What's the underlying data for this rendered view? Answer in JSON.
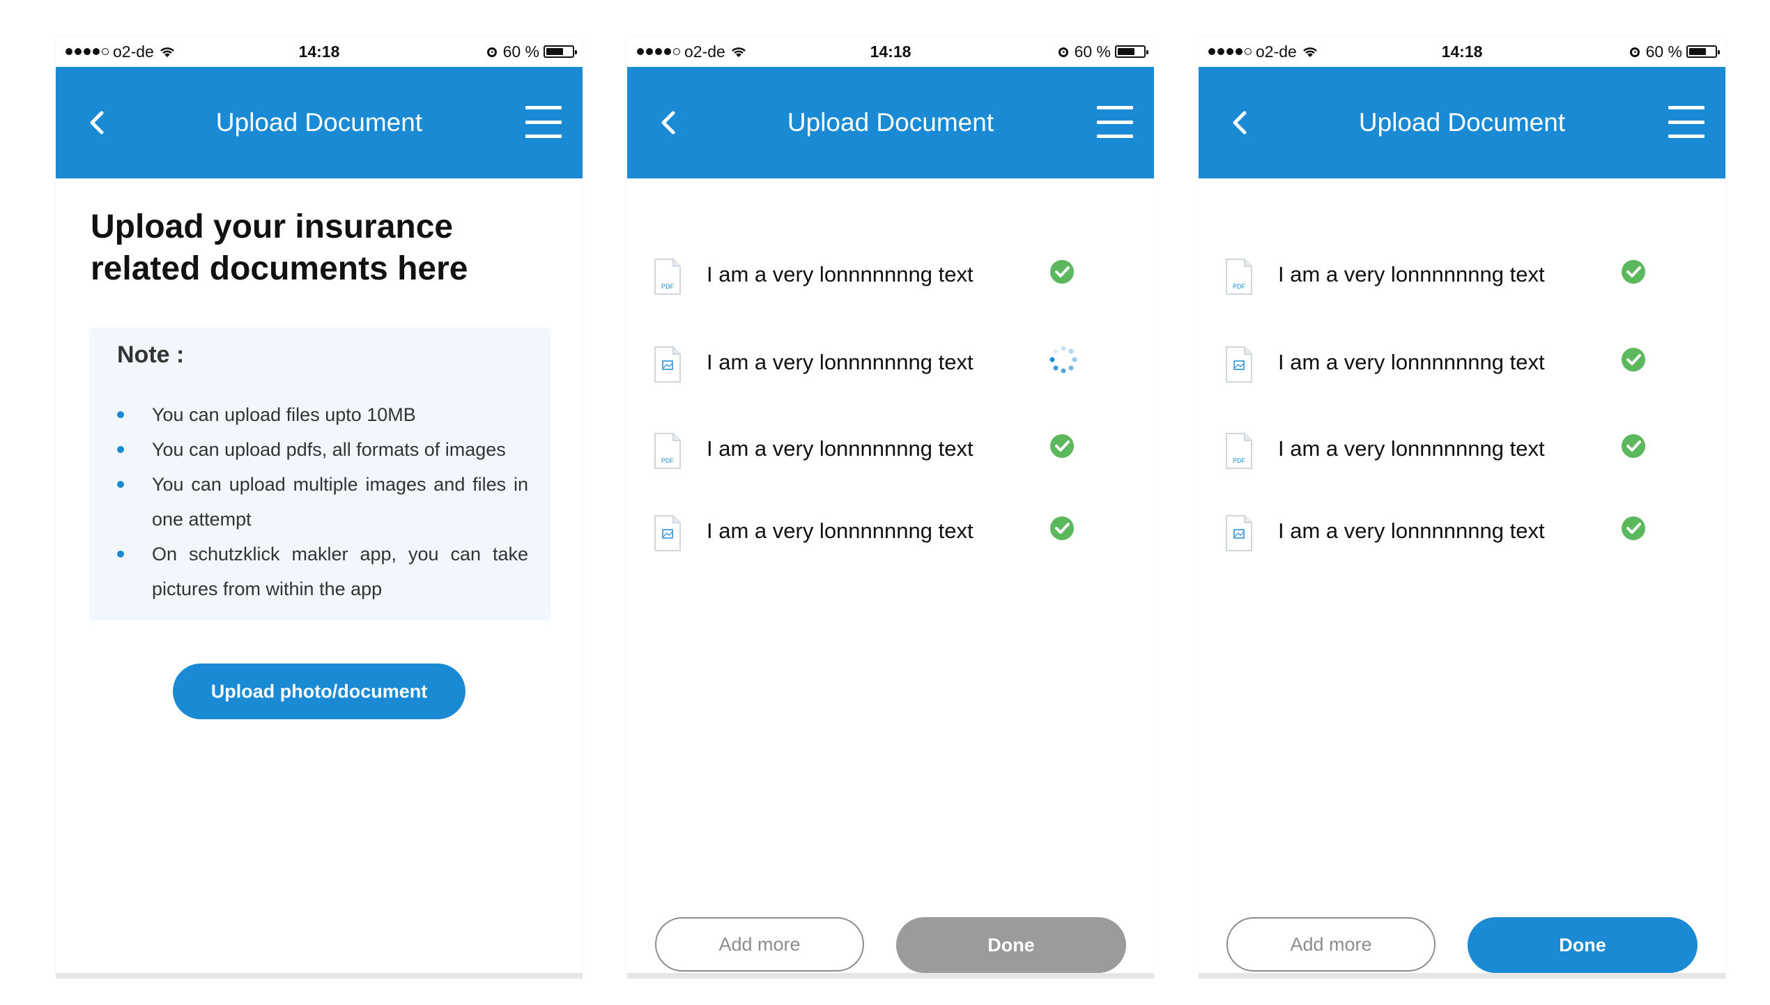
{
  "colors": {
    "primary": "#1a8ad4",
    "success": "#5cb85c",
    "disabled": "#9b9b9b",
    "note_bg": "#f1f7fc"
  },
  "status_bar": {
    "carrier": "o2-de",
    "time": "14:18",
    "battery": "60 %"
  },
  "header": {
    "title": "Upload Document",
    "back_icon": "chevron-left-icon",
    "menu_icon": "hamburger-menu-icon"
  },
  "screen1": {
    "heading": "Upload your insurance related documents here",
    "note_title": "Note :",
    "notes": [
      "You can upload files upto 10MB",
      "You can upload pdfs, all formats of images",
      "You can upload multiple images and files in one attempt",
      "On schutzklick makler app, you can take pictures from within the app"
    ],
    "upload_button": "Upload photo/document"
  },
  "screen2": {
    "files": [
      {
        "name": "I am a very lonnnnnnng text",
        "type": "pdf",
        "status": "done"
      },
      {
        "name": "I am a very lonnnnnnng text",
        "type": "image",
        "status": "loading"
      },
      {
        "name": "I am a very lonnnnnnng text",
        "type": "pdf",
        "status": "done"
      },
      {
        "name": "I am a very lonnnnnnng text",
        "type": "image",
        "status": "done"
      }
    ],
    "add_more": "Add more",
    "done": "Done",
    "done_enabled": false
  },
  "screen3": {
    "files": [
      {
        "name": "I am a very lonnnnnnng text",
        "type": "pdf",
        "status": "done"
      },
      {
        "name": "I am a very lonnnnnnng text",
        "type": "image",
        "status": "done"
      },
      {
        "name": "I am a very lonnnnnnng text",
        "type": "pdf",
        "status": "done"
      },
      {
        "name": "I am a very lonnnnnnng text",
        "type": "image",
        "status": "done"
      }
    ],
    "add_more": "Add more",
    "done": "Done",
    "done_enabled": true
  },
  "file_labels": {
    "pdf": "PDF"
  }
}
